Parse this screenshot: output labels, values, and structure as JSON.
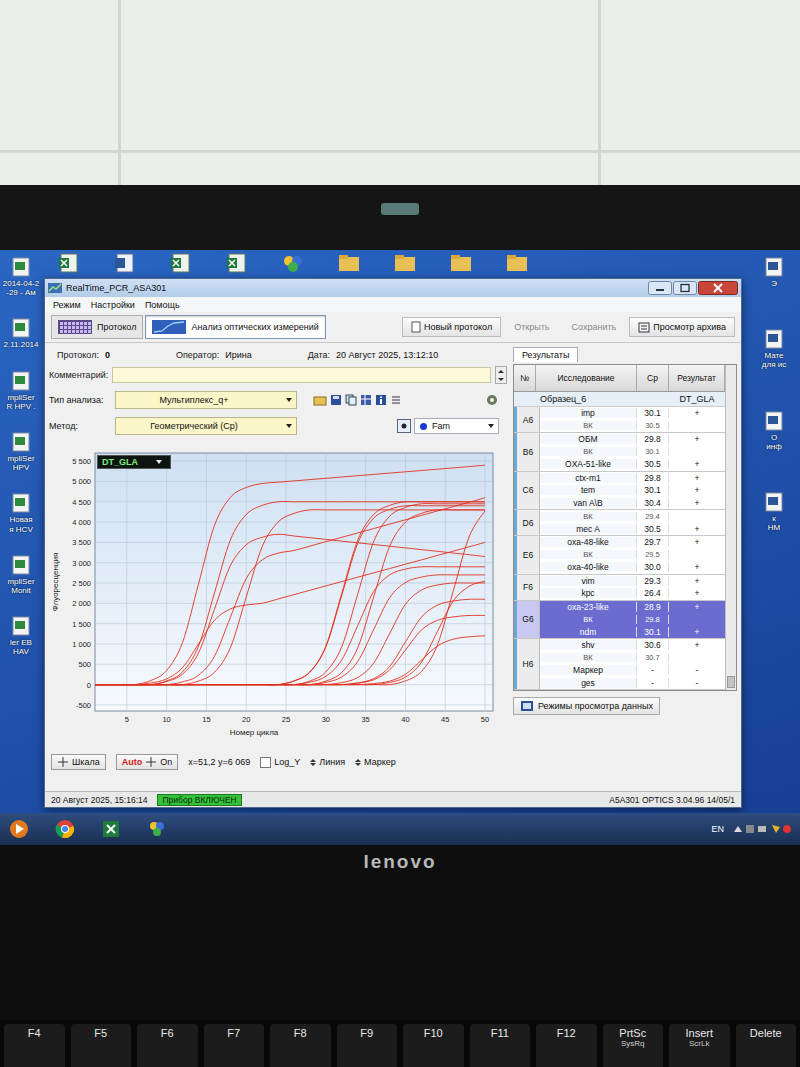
{
  "window": {
    "title": "RealTime_PCR_ASA301"
  },
  "menu": [
    "Режим",
    "Настройки",
    "Помощь"
  ],
  "mode_tabs": [
    {
      "label": "Протокол",
      "selected": false
    },
    {
      "label": "Анализ оптических измерений",
      "selected": true
    }
  ],
  "toolbar_buttons": [
    {
      "label": "Новый протокол",
      "disabled": false
    },
    {
      "label": "Открыть",
      "disabled": true
    },
    {
      "label": "Сохранить",
      "disabled": true
    },
    {
      "label": "Просмотр архива",
      "disabled": false
    }
  ],
  "protocol": {
    "protocol_label": "Протокол:",
    "protocol_value": "0",
    "operator_label": "Оператор:",
    "operator_value": "Ирина",
    "date_label": "Дата:",
    "date_value": "20 Август 2025, 13:12:10",
    "comment_label": "Комментарий:",
    "comment_value": ""
  },
  "analysis_type": {
    "label": "Тип анализа:",
    "value": "Мультиплекс_q+"
  },
  "method": {
    "label": "Метод:",
    "value": "Геометрический (Cp)"
  },
  "channel": {
    "value": "Fam",
    "color": "#1a3cd6"
  },
  "chart": {
    "test": "DT_GLA",
    "y_title": "Флуоресценция",
    "x_title": "Номер цикла",
    "y_ticks": [
      {
        "label": "5 500",
        "value": 5500
      },
      {
        "label": "5 000",
        "value": 5000
      },
      {
        "label": "4 500",
        "value": 4500
      },
      {
        "label": "4 000",
        "value": 4000
      },
      {
        "label": "3 500",
        "value": 3500
      },
      {
        "label": "3 000",
        "value": 3000
      },
      {
        "label": "2 500",
        "value": 2500
      },
      {
        "label": "2 000",
        "value": 2000
      },
      {
        "label": "1 500",
        "value": 1500
      },
      {
        "label": "1 000",
        "value": 1000
      },
      {
        "label": "500",
        "value": 500
      },
      {
        "label": "0",
        "value": 0
      },
      {
        "label": "-500",
        "value": -500
      }
    ],
    "x_ticks": [
      {
        "label": "5",
        "value": 5
      },
      {
        "label": "10",
        "value": 10
      },
      {
        "label": "15",
        "value": 15
      },
      {
        "label": "20",
        "value": 20
      },
      {
        "label": "25",
        "value": 25
      },
      {
        "label": "30",
        "value": 30
      },
      {
        "label": "35",
        "value": 35
      },
      {
        "label": "40",
        "value": 40
      },
      {
        "label": "45",
        "value": 45
      },
      {
        "label": "50",
        "value": 50
      }
    ],
    "cycles": [
      0,
      2,
      4,
      6,
      8,
      10,
      12,
      14,
      16,
      18,
      20,
      22,
      24,
      26,
      28,
      30,
      32,
      34,
      36,
      38,
      40,
      42,
      44,
      46,
      48,
      50
    ],
    "series": [
      {
        "values": [
          0,
          0,
          0,
          0,
          99,
          347,
          1040,
          2475,
          3911,
          4604,
          4851,
          4950,
          4982,
          5014,
          5046,
          5078,
          5110,
          5142,
          5174,
          5206,
          5238,
          5270,
          5302,
          5334,
          5366,
          5400
        ]
      },
      {
        "values": [
          0,
          0,
          0,
          0,
          0,
          90,
          315,
          945,
          2250,
          3555,
          4185,
          4410,
          4500,
          4500,
          4500,
          4500,
          4500,
          4500,
          4500,
          4500,
          4500,
          4500,
          4500,
          4500,
          4500,
          4500
        ]
      },
      {
        "values": [
          0,
          0,
          0,
          0,
          0,
          74,
          259,
          777,
          1850,
          2923,
          3441,
          3626,
          3700,
          3658,
          3616,
          3574,
          3532,
          3490,
          3448,
          3406,
          3364,
          3322,
          3280,
          3238,
          3196,
          3150
        ]
      },
      {
        "values": [
          0,
          0,
          0,
          0,
          0,
          0,
          66,
          231,
          693,
          1650,
          2607,
          3069,
          3234,
          3300,
          3408,
          3516,
          3624,
          3732,
          3840,
          3948,
          4056,
          4164,
          4272,
          4380,
          4488,
          4600
        ]
      },
      {
        "values": [
          0,
          0,
          0,
          0,
          0,
          0,
          0,
          86,
          301,
          903,
          2150,
          3397,
          3999,
          4214,
          4300,
          4300,
          4300,
          4300,
          4300,
          4300,
          4300,
          4300,
          4300,
          4300,
          4300,
          4300
        ]
      },
      {
        "values": [
          0,
          0,
          0,
          0,
          40,
          140,
          420,
          1000,
          1580,
          1860,
          1960,
          2000,
          2107,
          2214,
          2321,
          2428,
          2535,
          2642,
          2749,
          2856,
          2963,
          3070,
          3177,
          3284,
          3391,
          3500
        ]
      },
      {
        "values": [
          0,
          0,
          0,
          0,
          0,
          0,
          0,
          0,
          0,
          0,
          0,
          0,
          0,
          90,
          315,
          945,
          2250,
          3555,
          4185,
          4410,
          4500,
          4500,
          4500,
          4500,
          4500,
          4500
        ]
      },
      {
        "values": [
          0,
          0,
          0,
          0,
          0,
          0,
          0,
          0,
          0,
          0,
          0,
          0,
          0,
          88,
          308,
          924,
          2200,
          3476,
          4092,
          4312,
          4400,
          4400,
          4400,
          4400,
          4400,
          4400
        ]
      },
      {
        "values": [
          0,
          0,
          0,
          0,
          0,
          0,
          0,
          0,
          0,
          0,
          0,
          0,
          0,
          0,
          89,
          312,
          935,
          2225,
          3516,
          4139,
          4361,
          4450,
          4450,
          4450,
          4450,
          4450
        ]
      },
      {
        "values": [
          0,
          0,
          0,
          0,
          0,
          0,
          0,
          0,
          0,
          0,
          0,
          0,
          0,
          0,
          58,
          203,
          609,
          1450,
          2291,
          2697,
          2842,
          2900,
          2900,
          2900,
          2900,
          2900
        ]
      },
      {
        "values": [
          0,
          0,
          0,
          0,
          0,
          0,
          0,
          0,
          0,
          0,
          0,
          0,
          0,
          0,
          0,
          54,
          189,
          567,
          1350,
          2133,
          2511,
          2646,
          2700,
          2700,
          2700,
          2700
        ]
      },
      {
        "values": [
          0,
          0,
          0,
          0,
          0,
          0,
          0,
          0,
          0,
          0,
          0,
          0,
          0,
          0,
          0,
          86,
          301,
          903,
          2150,
          3397,
          3999,
          4214,
          4300,
          4300,
          4300,
          4300
        ]
      },
      {
        "values": [
          0,
          0,
          0,
          0,
          0,
          0,
          0,
          0,
          0,
          0,
          0,
          0,
          0,
          0,
          0,
          0,
          50,
          175,
          525,
          1250,
          1975,
          2325,
          2450,
          2500,
          2500,
          2500
        ]
      },
      {
        "values": [
          0,
          0,
          0,
          0,
          0,
          0,
          0,
          0,
          0,
          0,
          0,
          0,
          0,
          0,
          0,
          0,
          0,
          42,
          147,
          441,
          1050,
          1659,
          1953,
          2058,
          2100,
          2100
        ]
      },
      {
        "values": [
          0,
          0,
          0,
          0,
          0,
          0,
          0,
          0,
          0,
          0,
          0,
          0,
          0,
          0,
          0,
          0,
          0,
          34,
          119,
          357,
          850,
          1343,
          1581,
          1666,
          1700,
          1700
        ]
      },
      {
        "values": [
          0,
          0,
          0,
          0,
          0,
          0,
          0,
          0,
          0,
          0,
          0,
          0,
          0,
          0,
          0,
          0,
          0,
          0,
          24,
          84,
          252,
          600,
          948,
          1116,
          1176,
          1200
        ]
      },
      {
        "values": [
          0,
          0,
          0,
          0,
          0,
          0,
          0,
          0,
          0,
          0,
          0,
          0,
          0,
          0,
          0,
          0,
          0,
          0,
          0,
          52,
          182,
          546,
          1300,
          2054,
          2418,
          2548
        ]
      },
      {
        "values": [
          0,
          0,
          0,
          0,
          0,
          0,
          0,
          0,
          0,
          0,
          0,
          0,
          0,
          0,
          0,
          0,
          0,
          0,
          0,
          0,
          92,
          322,
          966,
          2300,
          3634,
          4278
        ]
      }
    ]
  },
  "chart_controls": {
    "scale": "Шкала",
    "auto": "Auto",
    "auto_state": "On",
    "cursor": "x=51,2 y=6 069",
    "log_y": {
      "label": "Log_Y",
      "checked": false
    },
    "line": "Линия",
    "marker": "Маркер"
  },
  "results": {
    "tab": "Результаты",
    "columns": [
      "№",
      "Исследование",
      "Cp",
      "Результат"
    ],
    "sample": {
      "name": "Образец_6",
      "test": "DT_GLA"
    },
    "wells": [
      {
        "well": "A6",
        "selected": false,
        "rows": [
          {
            "name": "imp",
            "cp": "30.1",
            "result": "+",
            "control": false
          },
          {
            "name": "ВК",
            "cp": "30.5",
            "result": "",
            "control": true
          }
        ]
      },
      {
        "well": "B6",
        "selected": false,
        "rows": [
          {
            "name": "ОБМ",
            "cp": "29.8",
            "result": "+",
            "control": false
          },
          {
            "name": "ВК",
            "cp": "30.1",
            "result": "",
            "control": true
          },
          {
            "name": "OXA-51-like",
            "cp": "30.5",
            "result": "+",
            "control": false
          }
        ]
      },
      {
        "well": "C6",
        "selected": false,
        "rows": [
          {
            "name": "ctx-m1",
            "cp": "29.8",
            "result": "+",
            "control": false
          },
          {
            "name": "tem",
            "cp": "30.1",
            "result": "+",
            "control": false
          },
          {
            "name": "van A\\B",
            "cp": "30.4",
            "result": "+",
            "control": false
          }
        ]
      },
      {
        "well": "D6",
        "selected": false,
        "rows": [
          {
            "name": "ВК",
            "cp": "29.4",
            "result": "",
            "control": true
          },
          {
            "name": "mec A",
            "cp": "30.5",
            "result": "+",
            "control": false
          }
        ]
      },
      {
        "well": "E6",
        "selected": false,
        "rows": [
          {
            "name": "oxa-48-like",
            "cp": "29.7",
            "result": "+",
            "control": false
          },
          {
            "name": "ВК",
            "cp": "29.5",
            "result": "",
            "control": true
          },
          {
            "name": "oxa-40-like",
            "cp": "30.0",
            "result": "+",
            "control": false
          }
        ]
      },
      {
        "well": "F6",
        "selected": false,
        "rows": [
          {
            "name": "vim",
            "cp": "29.3",
            "result": "+",
            "control": false
          },
          {
            "name": "kpc",
            "cp": "26.4",
            "result": "+",
            "control": false
          }
        ]
      },
      {
        "well": "G6",
        "selected": true,
        "rows": [
          {
            "name": "oxa-23-like",
            "cp": "28.9",
            "result": "+",
            "control": false
          },
          {
            "name": "ВК",
            "cp": "29.8",
            "result": "",
            "control": true
          },
          {
            "name": "ndm",
            "cp": "30.1",
            "result": "+",
            "control": false
          }
        ]
      },
      {
        "well": "H6",
        "selected": false,
        "rows": [
          {
            "name": "shv",
            "cp": "30.6",
            "result": "+",
            "control": false
          },
          {
            "name": "ВК",
            "cp": "30.7",
            "result": "",
            "control": true
          },
          {
            "name": "Маркер",
            "cp": "-",
            "result": "-",
            "control": false
          },
          {
            "name": "ges",
            "cp": "-",
            "result": "-",
            "control": false
          }
        ]
      }
    ],
    "view_button": "Режимы просмотра данных"
  },
  "status_bar": {
    "time": "20 Август 2025, 15:16:14",
    "device": "Прибор ВКЛЮЧЕН",
    "version": "A5A301 OPTICS 3.04.96 14/05/1"
  },
  "taskbar": {
    "language": "EN"
  },
  "desktop": {
    "left_icons": [
      {
        "lines": [
          "2014-04-2",
          "-29 - Ам"
        ]
      },
      {
        "lines": [
          "2.11.2014"
        ]
      },
      {
        "lines": [
          "mpliSer",
          "R HPV ."
        ]
      },
      {
        "lines": [
          "mpliSer",
          "HPV"
        ]
      },
      {
        "lines": [
          "Новая",
          "я HCV"
        ]
      },
      {
        "lines": [
          "mpliSer",
          "Monit"
        ]
      },
      {
        "lines": [
          "ler EB",
          "HAV"
        ]
      }
    ],
    "right_icons": [
      {
        "lines": [
          "Э"
        ]
      },
      {
        "lines": [
          "Мате",
          "для ис"
        ]
      },
      {
        "lines": [
          "О",
          "инф"
        ]
      },
      {
        "lines": [
          "к",
          "НМ"
        ]
      }
    ]
  },
  "laptop": {
    "brand": "lenovo"
  },
  "keyboard": {
    "keys": [
      {
        "label": "F4",
        "sub": ""
      },
      {
        "label": "F5",
        "sub": ""
      },
      {
        "label": "F6",
        "sub": ""
      },
      {
        "label": "F7",
        "sub": ""
      },
      {
        "label": "F8",
        "sub": ""
      },
      {
        "label": "F9",
        "sub": ""
      },
      {
        "label": "F10",
        "sub": ""
      },
      {
        "label": "F11",
        "sub": ""
      },
      {
        "label": "F12",
        "sub": ""
      },
      {
        "label": "PrtSc",
        "sub": "SysRq"
      },
      {
        "label": "Insert",
        "sub": "ScrLk"
      },
      {
        "label": "Delete",
        "sub": ""
      }
    ]
  }
}
